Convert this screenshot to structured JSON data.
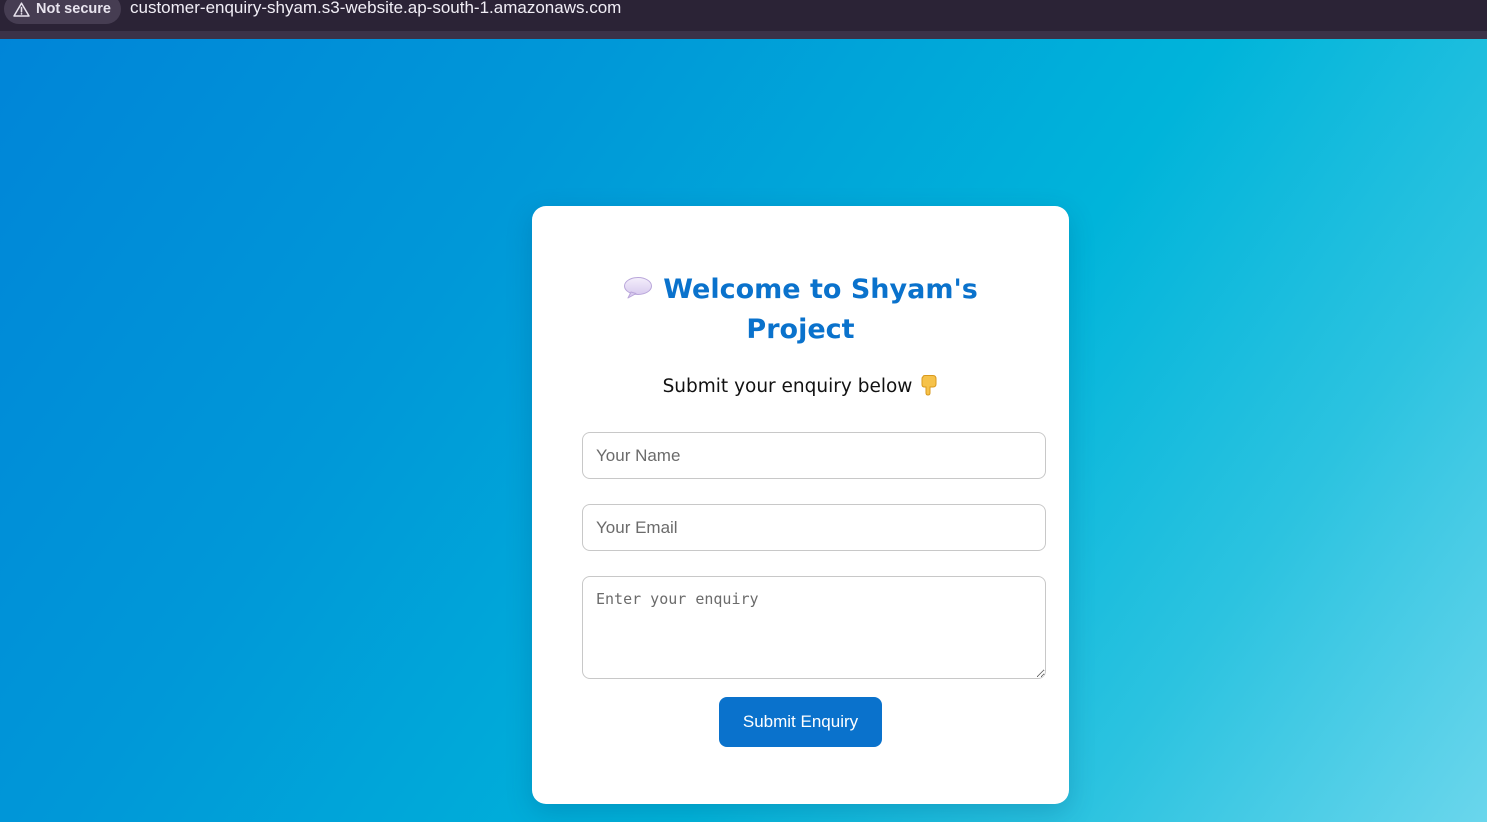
{
  "browser": {
    "security_label": "Not secure",
    "security_icon": "warning-triangle-icon",
    "url": "customer-enquiry-shyam.s3-website.ap-south-1.amazonaws.com"
  },
  "card": {
    "title_icon": "speech-bubble-icon",
    "title": "Welcome to Shyam's Project",
    "subtitle": "Submit your enquiry below",
    "subtitle_icon": "pointing-down-hand-icon",
    "name_placeholder": "Your Name",
    "email_placeholder": "Your Email",
    "enquiry_placeholder": "Enter your enquiry",
    "submit_label": "Submit Enquiry"
  },
  "colors": {
    "accent": "#0a72cc",
    "background_start": "#0085d8",
    "background_end": "#6ad6ec",
    "browser_bar": "#2b2336"
  }
}
